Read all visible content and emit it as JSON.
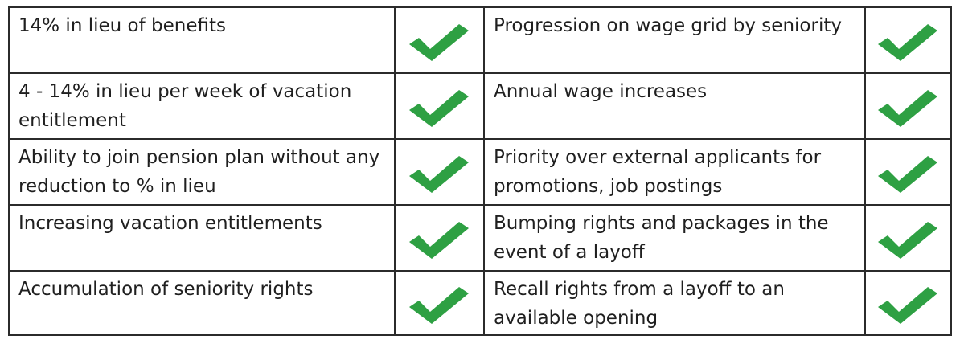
{
  "rows": [
    {
      "left": {
        "text": "14% in lieu of benefits",
        "checked": true
      },
      "right": {
        "text": "Progression on wage grid by seniority",
        "checked": true
      }
    },
    {
      "left": {
        "text": "4 - 14% in lieu per week of vacation entitlement",
        "checked": true
      },
      "right": {
        "text": "Annual wage increases",
        "checked": true
      }
    },
    {
      "left": {
        "text": "Ability to join pension plan without any reduction to % in lieu",
        "checked": true
      },
      "right": {
        "text": "Priority over external applicants for promotions, job postings",
        "checked": true
      }
    },
    {
      "left": {
        "text": "Increasing vacation entitlements",
        "checked": true
      },
      "right": {
        "text": "Bumping rights and packages in the event of a layoff",
        "checked": true
      }
    },
    {
      "left": {
        "text": "Accumulation of seniority rights",
        "checked": true
      },
      "right": {
        "text": "Recall rights from a layoff to an available opening",
        "checked": true
      }
    }
  ],
  "colors": {
    "check": "#2ea043",
    "border": "#2b2b2b",
    "text": "#1f1f1f"
  },
  "icons": {
    "check": "checkmark-icon"
  }
}
